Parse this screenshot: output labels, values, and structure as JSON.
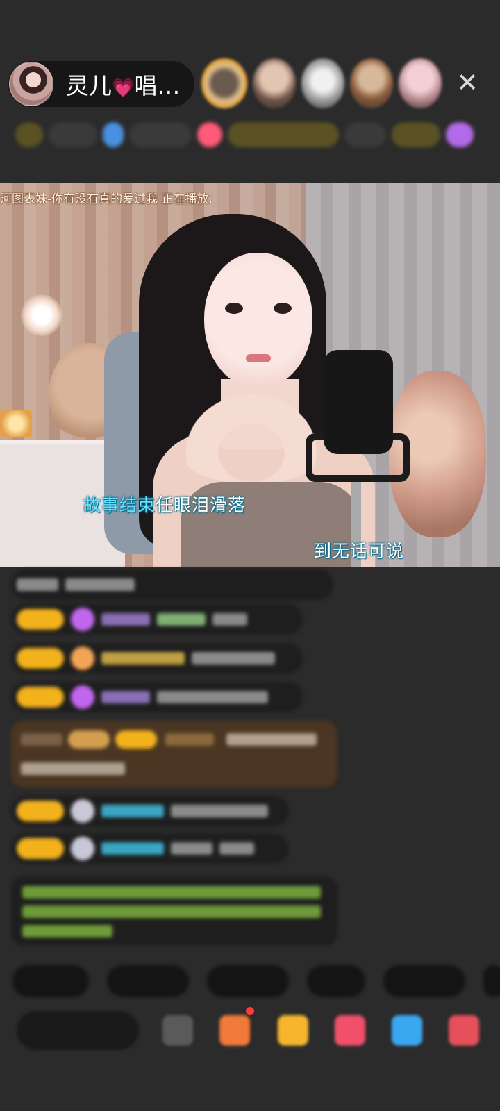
{
  "header": {
    "host_name": "灵儿",
    "host_name_suffix": "唱…",
    "close_icon": "close-icon"
  },
  "video": {
    "now_playing": "河图表妹-你有没有真的爱过我  正在播放:",
    "lyric_line_1_highlight": "故事结束",
    "lyric_line_1_rest": "任眼泪滑落",
    "lyric_line_2": "到无话可说"
  },
  "colors": {
    "background": "#2b2b2b",
    "lyric_highlight": "#63e3ff",
    "level_badge": "#f3b21c",
    "heart": "#ff4d8d"
  },
  "icons": [
    "close-icon",
    "heart-icon",
    "gift-icon",
    "more-icon"
  ]
}
